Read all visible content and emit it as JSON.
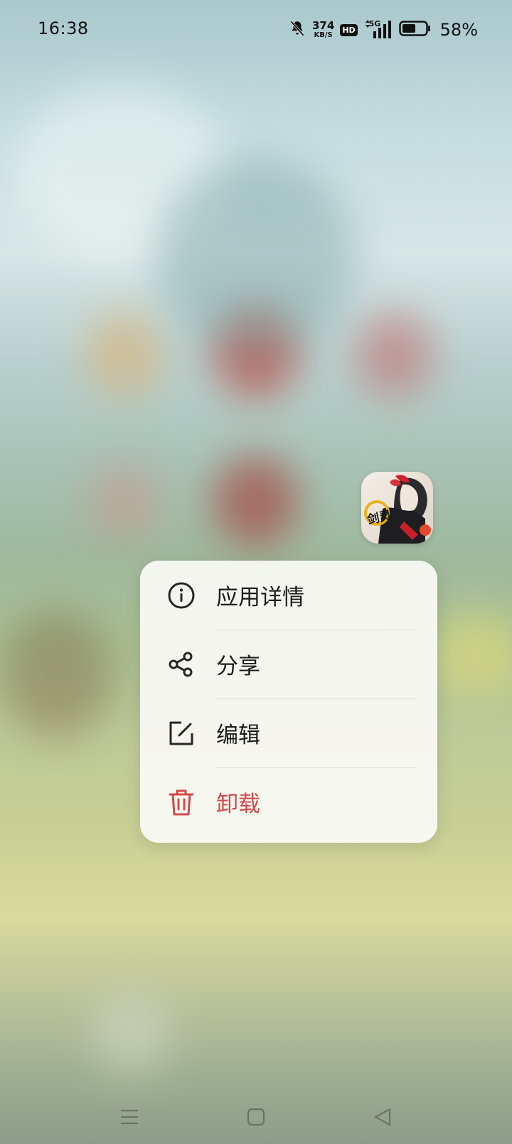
{
  "status_bar": {
    "time": "16:38",
    "net_speed_value": "374",
    "net_speed_unit": "KB/S",
    "hd_badge": "HD",
    "network_type": "5G",
    "battery_percent": "58%",
    "battery_level": 0.58,
    "icons": [
      "bell-muted-icon",
      "hd-icon",
      "signal-icon",
      "battery-icon"
    ]
  },
  "app": {
    "icon": "game-app-icon",
    "logo_text": "剑灵"
  },
  "context_menu": {
    "items": [
      {
        "label": "应用详情",
        "icon": "info-icon"
      },
      {
        "label": "分享",
        "icon": "share-icon"
      },
      {
        "label": "编辑",
        "icon": "edit-icon"
      },
      {
        "label": "卸载",
        "icon": "trash-icon"
      }
    ],
    "danger_color": "#d5484a"
  },
  "nav_bar": {
    "icons": [
      "menu-icon",
      "home-icon",
      "back-icon"
    ]
  }
}
